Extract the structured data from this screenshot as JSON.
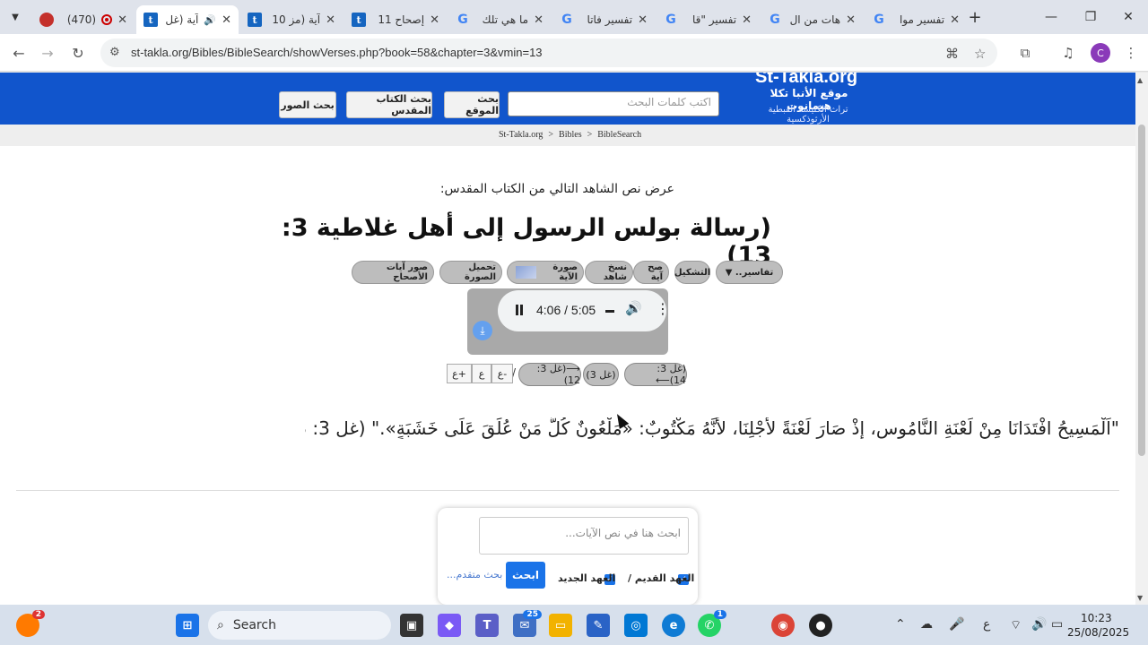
{
  "browser": {
    "tabs": [
      {
        "title": "(470)",
        "favicon": "youtube-icon",
        "recording": true
      },
      {
        "title": "آية (غل",
        "favicon": "takla-icon",
        "audio": true,
        "active": true
      },
      {
        "title": "آية (مز 10",
        "favicon": "takla-icon"
      },
      {
        "title": "إصحاح 11",
        "favicon": "takla-icon"
      },
      {
        "title": "ما هي تلك",
        "favicon": "google-icon"
      },
      {
        "title": "تفسير فاتا",
        "favicon": "google-icon"
      },
      {
        "title": "تفسير \"قا",
        "favicon": "google-icon"
      },
      {
        "title": "هات من ال",
        "favicon": "google-icon"
      },
      {
        "title": "تفسير موا",
        "favicon": "google-icon"
      }
    ],
    "url": "st-takla.org/Bibles/BibleSearch/showVerses.php?book=58&chapter=3&vmin=13",
    "profile_initial": "C"
  },
  "site": {
    "logo_title": "St-Takla.org",
    "logo_subtitle": "موقع الأنبا تكلا هيمانوت",
    "logo_tagline": "تراث الكنيسة القبطية الأرثوذكسية",
    "search_placeholder": "اكتب كلمات البحث",
    "btn_site_search": "بحث الموقع",
    "btn_bible_search": "بحث الكتاب المقدس",
    "btn_image_search": "بحث الصور",
    "breadcrumb": [
      "St-Takla.org",
      ">",
      "Bibles",
      ">",
      "BibleSearch"
    ]
  },
  "content": {
    "intro": "عرض نص الشاهد التالي من الكتاب المقدس:",
    "verse_title": "(رسالة بولس الرسول إلى أهل غلاطية 3: 13)",
    "tools": {
      "tafasir": "تفاسير..",
      "tashkeel": "التشكيل",
      "verse_image": "صح آية",
      "copy_ref": "نسخ شاهد",
      "verse_picture": "صورة الآية",
      "download_image": "تحميل الصورة",
      "chapter_images": "صور آيات الأصحاح"
    },
    "audio": {
      "time": "4:06 / 5:05"
    },
    "nav": {
      "next": "(غل 3: 14)⟵",
      "chapter": "(غل 3)",
      "prev": "⟶(غل 3: 12)",
      "sep": "/",
      "font_minus": "ع-",
      "font_reset": "ع",
      "font_plus": "ع+"
    },
    "verse_text": "\"اَلْمَسِيحُ افْتَدَانَا مِنْ لَعْنَةِ النَّامُوسِ، إِذْ صَارَ لَعْنَةً لأَجْلِنَا، لأَنَّهُ مَكْتُوبٌ: «مَلْعُونٌ كُلُّ مَنْ عُلِّقَ عَلَى خَشَبَةٍ».\" (غل 3: 13)."
  },
  "verse_search": {
    "placeholder": "ابحث هنا في نص الآيات...",
    "old_testament": "العهد القديم /",
    "new_testament": "العهد الجديد",
    "search_btn": "ابحث",
    "advanced": "بحث متقدم..."
  },
  "taskbar": {
    "search_label": "Search",
    "notif_count": "2",
    "teams_badge": "25",
    "whatsapp_badge": "1",
    "lang": "ع",
    "time": "10:23",
    "date": "25/08/2025"
  }
}
